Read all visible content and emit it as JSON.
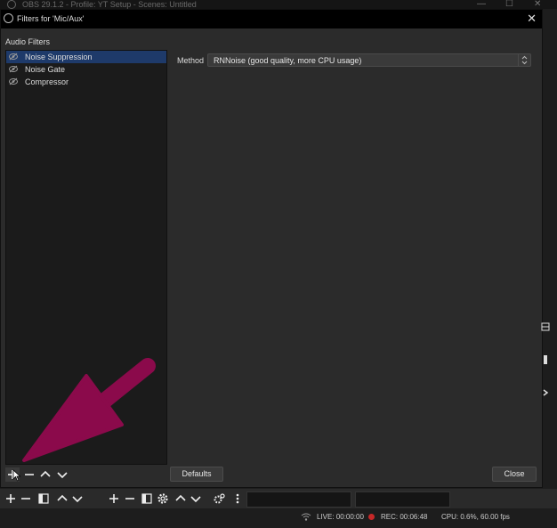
{
  "window": {
    "title": "OBS 29.1.2 - Profile: YT Setup - Scenes: Untitled"
  },
  "dialog": {
    "title": "Filters for 'Mic/Aux'",
    "section_label": "Audio Filters",
    "filters": [
      {
        "label": "Noise Suppression",
        "selected": true
      },
      {
        "label": "Noise Gate",
        "selected": false
      },
      {
        "label": "Compressor",
        "selected": false
      }
    ],
    "properties": {
      "method_label": "Method",
      "method_value": "RNNoise (good quality, more CPU usage)"
    },
    "defaults_button": "Defaults",
    "close_button": "Close"
  },
  "status": {
    "live": "LIVE: 00:00:00",
    "rec": "REC: 00:06:48",
    "cpu": "CPU: 0.6%, 60.00 fps"
  },
  "colors": {
    "selection": "#1e3a6a",
    "annotation_arrow": "#8b0a4b",
    "rec_dot": "#c62828"
  },
  "icons": [
    "eye-icon",
    "plus-icon",
    "minus-icon",
    "up-arrow-icon",
    "down-arrow-icon",
    "close-icon",
    "gear-icon",
    "more-icon",
    "filter-icon",
    "mouse-cursor-icon",
    "wifi-icon"
  ]
}
